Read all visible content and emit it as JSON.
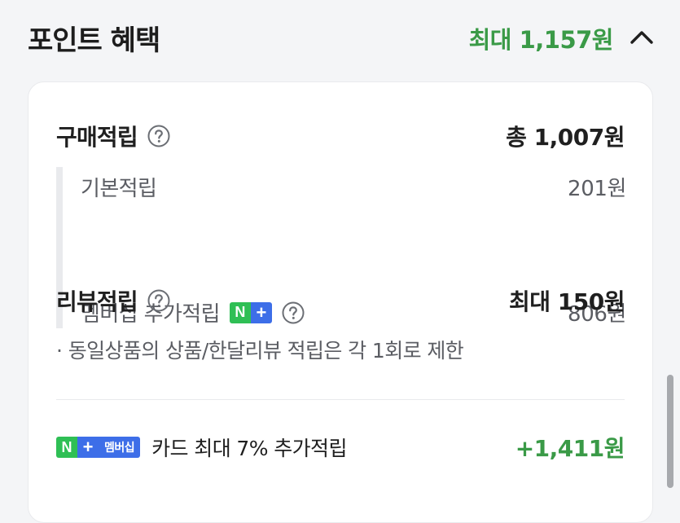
{
  "header": {
    "title": "포인트 혜택",
    "max_total": "최대 1,157원",
    "collapse_icon": "chevron-up-icon"
  },
  "purchase": {
    "title": "구매적립",
    "total": "총 1,007원",
    "help_icon": "question-circle-icon",
    "items": [
      {
        "label": "기본적립",
        "value": "201원"
      },
      {
        "label": "멤버십 추가적립",
        "value": "806원",
        "badge": {
          "n": "N",
          "plus": "+"
        }
      }
    ]
  },
  "review": {
    "title": "리뷰적립",
    "value": "최대 150원",
    "help_icon": "question-circle-icon",
    "note": "· 동일상품의 상품/한달리뷰 적립은 각 1회로 제한"
  },
  "card_benefit": {
    "badge": {
      "n": "N",
      "plus": "+",
      "membership": "멤버십"
    },
    "label": "카드 최대 7% 추가적립",
    "value": "+1,411원"
  },
  "colors": {
    "accent_green": "#3a9a47",
    "naver_green": "#2fbf55",
    "membership_blue": "#3d6ee8"
  }
}
